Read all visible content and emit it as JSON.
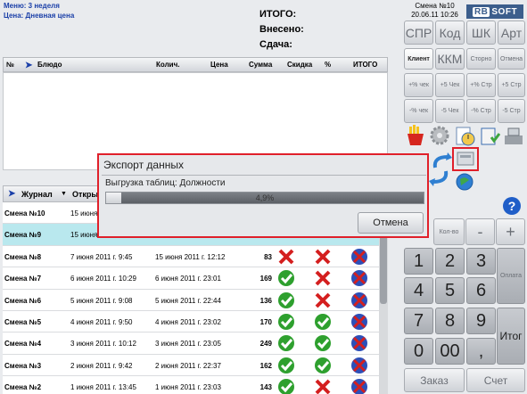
{
  "info": {
    "menu": "Меню: 3 неделя",
    "price": "Цена: Дневная цена"
  },
  "totals": {
    "itogo": "ИТОГО:",
    "vneseno": "Внесено:",
    "sdacha": "Сдача:"
  },
  "order_table": {
    "headers": [
      "№",
      "Блюдо",
      "Колич.",
      "Цена",
      "Сумма",
      "Скидка",
      "%",
      "ИТОГО"
    ]
  },
  "journal": {
    "headers": [
      "Журнал",
      "Откры"
    ],
    "rows": [
      {
        "name": "Смена №10",
        "open": "15 июня",
        "close": "",
        "sum": "",
        "c1": "",
        "c2": "",
        "c3": ""
      },
      {
        "name": "Смена №9",
        "open": "15 июня",
        "close": "",
        "sum": "",
        "c1": "",
        "c2": "",
        "c3": "",
        "selected": true
      },
      {
        "name": "Смена №8",
        "open": "7 июня 2011 г. 9:45",
        "close": "15 июня 2011 г. 12:12",
        "sum": "83",
        "c1": "x",
        "c2": "x",
        "c3": "i"
      },
      {
        "name": "Смена №7",
        "open": "6 июня 2011 г. 10:29",
        "close": "6 июня 2011 г. 23:01",
        "sum": "169",
        "c1": "v",
        "c2": "x",
        "c3": "i"
      },
      {
        "name": "Смена №6",
        "open": "5 июня 2011 г. 9:08",
        "close": "5 июня 2011 г. 22:44",
        "sum": "136",
        "c1": "v",
        "c2": "x",
        "c3": "i"
      },
      {
        "name": "Смена №5",
        "open": "4 июня 2011 г. 9:50",
        "close": "4 июня 2011 г. 23:02",
        "sum": "170",
        "c1": "v",
        "c2": "v",
        "c3": "i"
      },
      {
        "name": "Смена №4",
        "open": "3 июня 2011 г. 10:12",
        "close": "3 июня 2011 г. 23:05",
        "sum": "249",
        "c1": "v",
        "c2": "v",
        "c3": "i"
      },
      {
        "name": "Смена №3",
        "open": "2 июня 2011 г. 9:42",
        "close": "2 июня 2011 г. 22:37",
        "sum": "162",
        "c1": "v",
        "c2": "v",
        "c3": "i"
      },
      {
        "name": "Смена №2",
        "open": "1 июня 2011 г. 13:45",
        "close": "1 июня 2011 г. 23:03",
        "sum": "143",
        "c1": "v",
        "c2": "x",
        "c3": "i"
      }
    ]
  },
  "header_right": {
    "shift": "Смена №10",
    "datetime": "20.06.11 10:26",
    "logo_a": "RB",
    "logo_b": "SOFT"
  },
  "top_buttons": [
    "СПР",
    "Код",
    "ШК",
    "Арт"
  ],
  "row2": [
    "Клиент",
    "ККМ",
    "Сторно",
    "Отмена"
  ],
  "row3": [
    "+% чек",
    "+5 Чек",
    "+% Стр",
    "+5 Стр"
  ],
  "row4": [
    "-% чек",
    "-5 Чек",
    "-% Стр",
    "-5 Стр"
  ],
  "keypad": {
    "qty": "Кол-во",
    "minus": "-",
    "plus": "+",
    "help": "?",
    "digits": [
      "1",
      "2",
      "3",
      "4",
      "5",
      "6",
      "7",
      "8",
      "9",
      "0",
      "00",
      ","
    ],
    "oplata": "Оплата",
    "itog": "Итог",
    "zakaz": "Заказ",
    "schet": "Счет"
  },
  "dialog": {
    "title": "Экспорт данных",
    "text": "Выгрузка таблиц: Должности",
    "progress": 0.049,
    "progress_label": "4,9%",
    "cancel": "Отмена"
  },
  "colors": {
    "accent": "#e0202a",
    "selected": "#b9e8ee",
    "brand": "#3c5e8c"
  }
}
